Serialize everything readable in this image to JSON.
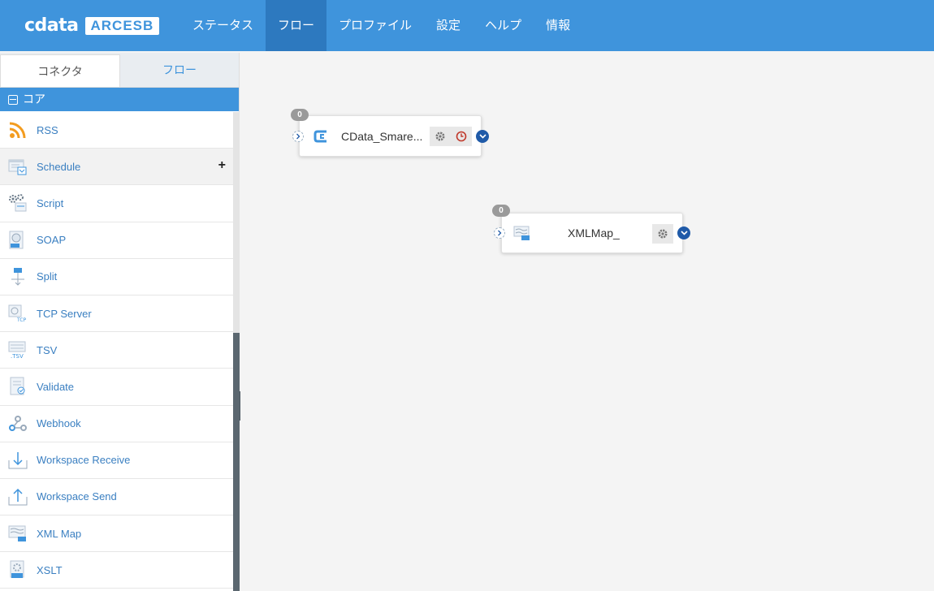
{
  "app": {
    "logo_main": "cdata",
    "logo_product": "ARCESB"
  },
  "nav": {
    "items": [
      {
        "label": "ステータス"
      },
      {
        "label": "フロー",
        "active": true
      },
      {
        "label": "プロファイル"
      },
      {
        "label": "設定"
      },
      {
        "label": "ヘルプ"
      },
      {
        "label": "情報"
      }
    ]
  },
  "sidebar": {
    "tabs": [
      {
        "label": "コネクタ",
        "active": true
      },
      {
        "label": "フロー"
      }
    ],
    "group": {
      "label": "コア",
      "expanded": true
    },
    "items": [
      {
        "label": "RSS",
        "icon": "rss-icon"
      },
      {
        "label": "Schedule",
        "icon": "schedule-icon",
        "hover": true
      },
      {
        "label": "Script",
        "icon": "script-icon"
      },
      {
        "label": "SOAP",
        "icon": "soap-icon"
      },
      {
        "label": "Split",
        "icon": "split-icon"
      },
      {
        "label": "TCP Server",
        "icon": "tcp-server-icon"
      },
      {
        "label": "TSV",
        "icon": "tsv-icon"
      },
      {
        "label": "Validate",
        "icon": "validate-icon"
      },
      {
        "label": "Webhook",
        "icon": "webhook-icon"
      },
      {
        "label": "Workspace Receive",
        "icon": "workspace-receive-icon"
      },
      {
        "label": "Workspace Send",
        "icon": "workspace-send-icon"
      },
      {
        "label": "XML Map",
        "icon": "xml-map-icon"
      },
      {
        "label": "XSLT",
        "icon": "xslt-icon"
      }
    ],
    "add_symbol": "+"
  },
  "canvas": {
    "nodes": [
      {
        "label": "CData_Smare...",
        "count": "0",
        "icon": "cdata-connector-icon",
        "has_schedule": true
      },
      {
        "label": "XMLMap_",
        "count": "0",
        "icon": "xml-map-icon",
        "has_schedule": false
      }
    ]
  },
  "colors": {
    "primary": "#3f94dc",
    "nav_active": "#2d79bf",
    "link": "#3a7fc1",
    "port": "#1f5aa8",
    "clock": "#c0392b"
  }
}
